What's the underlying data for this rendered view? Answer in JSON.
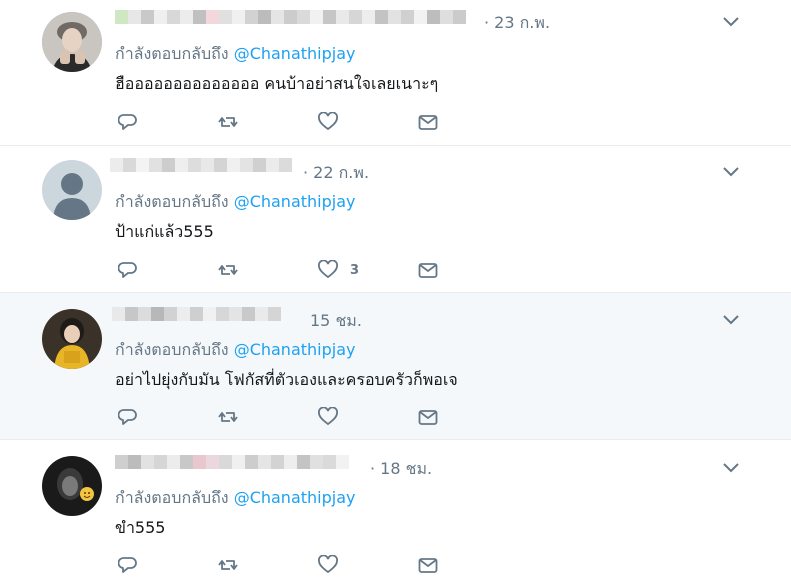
{
  "tweets": [
    {
      "timestamp": "· 23 ก.พ.",
      "reply_prefix": "กำลังตอบกลับถึง",
      "reply_handle": "@Chanathipjay",
      "text": "ฮืออออออออออออออ คนบ้าอย่าสนใจเลยเนาะๆ",
      "likes": "",
      "avatar": "celebrity-photo"
    },
    {
      "timestamp": "· 22 ก.พ.",
      "reply_prefix": "กำลังตอบกลับถึง",
      "reply_handle": "@Chanathipjay",
      "text": "ป้าแก่แล้ว555",
      "likes": "3",
      "avatar": "default-profile"
    },
    {
      "timestamp": "15 ชม.",
      "reply_prefix": "กำลังตอบกลับถึง",
      "reply_handle": "@Chanathipjay",
      "text": "อย่าไปยุ่งกับมัน โฟกัสที่ตัวเองและครอบครัวก็พอเจ",
      "likes": "",
      "avatar": "girl-yellow-outfit"
    },
    {
      "timestamp": "· 18 ชม.",
      "reply_prefix": "กำลังตอบกลับถึง",
      "reply_handle": "@Chanathipjay",
      "text": "ขำ555",
      "likes": "",
      "avatar": "dark-photo-emoji"
    }
  ],
  "icons": {
    "reply": "reply-icon",
    "retweet": "retweet-icon",
    "like": "heart-icon",
    "dm": "envelope-icon",
    "more": "chevron-down-icon"
  },
  "colors": {
    "link": "#1da1f2",
    "secondary_text": "#657786",
    "highlight_bg": "#f5f8fa",
    "divider": "#e6ecf0"
  }
}
